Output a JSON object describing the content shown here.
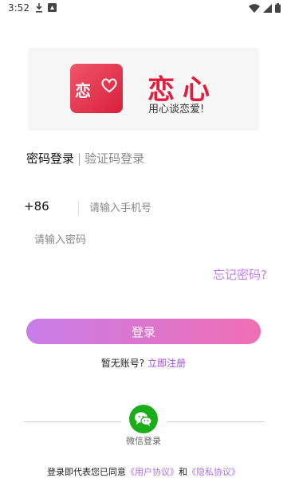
{
  "status_bar": {
    "time": "3:52"
  },
  "brand": {
    "icon_text": "恋",
    "title": "恋心",
    "slogan": "用心谈恋爱!"
  },
  "login_tabs": {
    "active": "密码登录",
    "separator": "|",
    "inactive": "验证码登录"
  },
  "phone": {
    "prefix": "+86",
    "placeholder": "请输入手机号",
    "value": ""
  },
  "password": {
    "placeholder": "请输入密码",
    "value": ""
  },
  "forgot_password": "忘记密码?",
  "login_button": "登录",
  "register": {
    "prompt": "暂无账号?",
    "link": "立即注册"
  },
  "wechat": {
    "label": "微信登录"
  },
  "agreement": {
    "prefix": "登录即代表您已同意",
    "user_agreement": "《用户协议》",
    "and": "和",
    "privacy": "《隐私协议》"
  },
  "colors": {
    "brand_red": "#e11d3b",
    "accent_purple": "#c57fe8",
    "wechat_green": "#1aad19"
  }
}
